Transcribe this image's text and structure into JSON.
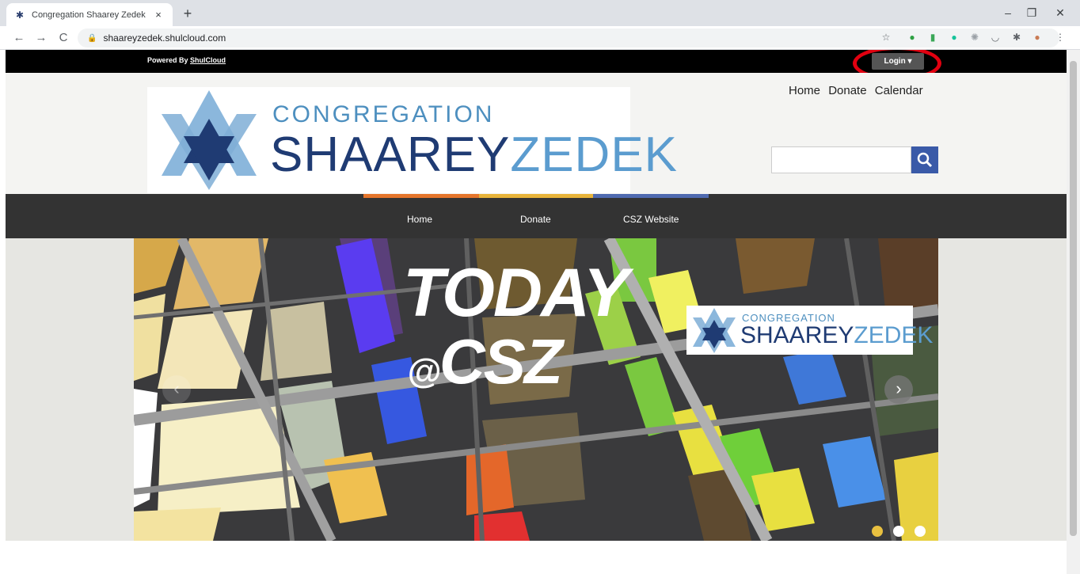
{
  "browser": {
    "tab_title": "Congregation Shaarey Zedek",
    "tab_close": "×",
    "new_tab": "+",
    "url": "shaareyzedek.shulcloud.com",
    "controls": {
      "minimize": "–",
      "restore": "❐",
      "close": "✕"
    },
    "nav": {
      "back": "←",
      "forward": "→",
      "reload": "C"
    }
  },
  "site": {
    "powered_by": "Powered By",
    "powered_link": "ShulCloud",
    "login_label": "Login ▾",
    "logo_sub": "CONGREGATION",
    "logo_main_a": "SHAAREY",
    "logo_main_b": "ZEDEK",
    "top_links": [
      "Home",
      "Donate",
      "Calendar"
    ],
    "nav_items": [
      "Home",
      "Donate",
      "CSZ Website"
    ],
    "hero": {
      "line1": "TODAY",
      "line2_at": "@",
      "line2": "CSZ",
      "logo_sub": "CONGREGATION",
      "logo_main_a": "SHAAREY",
      "logo_main_b": "ZEDEK",
      "prev": "‹",
      "next": "›"
    },
    "colors": {
      "accent_orange": "#e5752b",
      "accent_yellow": "#e8b43a",
      "accent_blue": "#4f6ab0",
      "highlight_circle": "#e10010"
    }
  }
}
